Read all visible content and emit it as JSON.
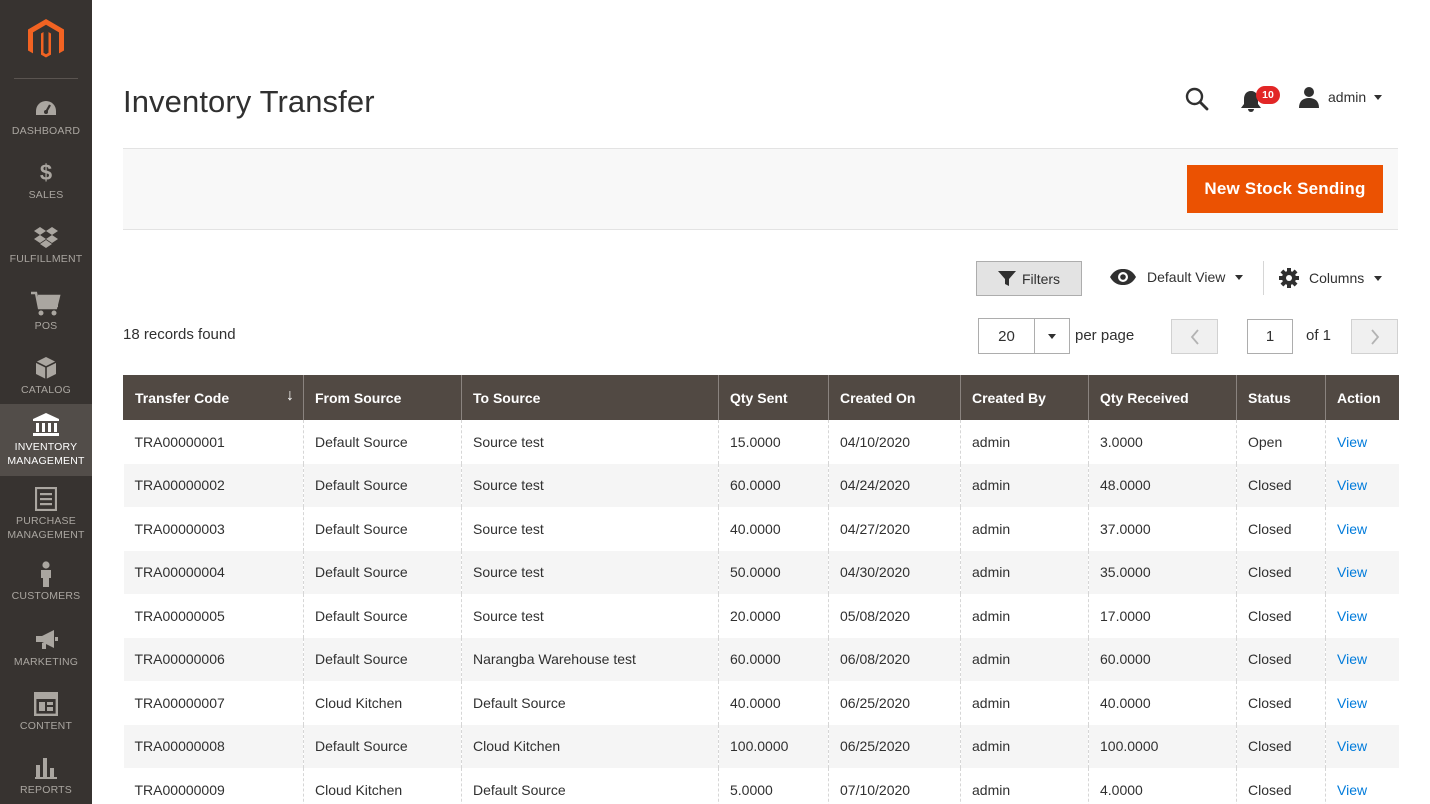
{
  "sidebar": {
    "items": [
      {
        "label": "Dashboard",
        "icon": "dashboard-icon"
      },
      {
        "label": "Sales",
        "icon": "dollar-icon"
      },
      {
        "label": "Fulfillment",
        "icon": "dropbox-icon"
      },
      {
        "label": "POS",
        "icon": "cart-icon"
      },
      {
        "label": "Catalog",
        "icon": "cube-icon"
      },
      {
        "label": "Inventory Management",
        "icon": "bank-icon"
      },
      {
        "label": "Purchase Management",
        "icon": "document-icon"
      },
      {
        "label": "Customers",
        "icon": "person-icon"
      },
      {
        "label": "Marketing",
        "icon": "megaphone-icon"
      },
      {
        "label": "Content",
        "icon": "layout-icon"
      },
      {
        "label": "Reports",
        "icon": "bar-chart-icon"
      }
    ],
    "active_index": 5
  },
  "header": {
    "title": "Inventory Transfer",
    "notifications_count": "10",
    "user_name": "admin"
  },
  "actions": {
    "new_button": "New Stock Sending"
  },
  "toolbar": {
    "filters_label": "Filters",
    "view_label": "Default View",
    "columns_label": "Columns",
    "records_found": "18 records found",
    "per_page_value": "20",
    "per_page_label": "per page",
    "current_page": "1",
    "total_pages_label": "of 1"
  },
  "grid": {
    "columns": [
      "Transfer Code",
      "From Source",
      "To Source",
      "Qty Sent",
      "Created On",
      "Created By",
      "Qty Received",
      "Status",
      "Action"
    ],
    "rows": [
      [
        "TRA00000001",
        "Default Source",
        "Source test",
        "15.0000",
        "04/10/2020",
        "admin",
        "3.0000",
        "Open",
        "View"
      ],
      [
        "TRA00000002",
        "Default Source",
        "Source test",
        "60.0000",
        "04/24/2020",
        "admin",
        "48.0000",
        "Closed",
        "View"
      ],
      [
        "TRA00000003",
        "Default Source",
        "Source test",
        "40.0000",
        "04/27/2020",
        "admin",
        "37.0000",
        "Closed",
        "View"
      ],
      [
        "TRA00000004",
        "Default Source",
        "Source test",
        "50.0000",
        "04/30/2020",
        "admin",
        "35.0000",
        "Closed",
        "View"
      ],
      [
        "TRA00000005",
        "Default Source",
        "Source test",
        "20.0000",
        "05/08/2020",
        "admin",
        "17.0000",
        "Closed",
        "View"
      ],
      [
        "TRA00000006",
        "Default Source",
        "Narangba Warehouse test",
        "60.0000",
        "06/08/2020",
        "admin",
        "60.0000",
        "Closed",
        "View"
      ],
      [
        "TRA00000007",
        "Cloud Kitchen",
        "Default Source",
        "40.0000",
        "06/25/2020",
        "admin",
        "40.0000",
        "Closed",
        "View"
      ],
      [
        "TRA00000008",
        "Default Source",
        "Cloud Kitchen",
        "100.0000",
        "06/25/2020",
        "admin",
        "100.0000",
        "Closed",
        "View"
      ],
      [
        "TRA00000009",
        "Cloud Kitchen",
        "Default Source",
        "5.0000",
        "07/10/2020",
        "admin",
        "4.0000",
        "Closed",
        "View"
      ]
    ]
  },
  "colors": {
    "sidebar_bg": "#373330",
    "accent_orange": "#eb5202",
    "header_row": "#514943",
    "link_blue": "#007bdb",
    "badge_red": "#e22626"
  }
}
